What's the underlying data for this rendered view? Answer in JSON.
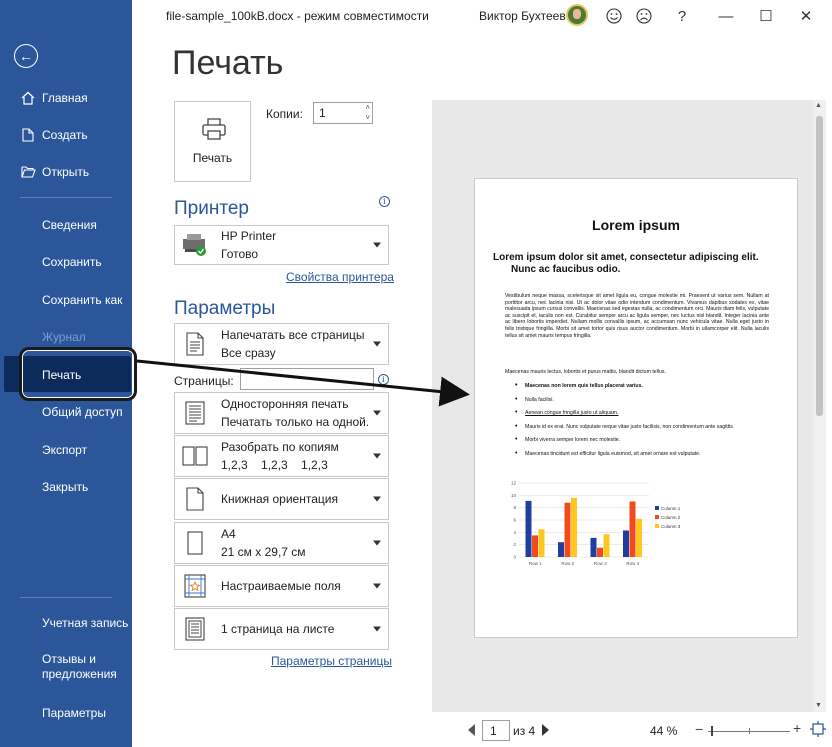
{
  "titlebar": {
    "document_title": "file-sample_100kB.docx  -  режим совместимости",
    "user_name": "Виктор Бухтеев",
    "icons": [
      "avatar",
      "smile-icon",
      "frown-icon",
      "help-icon",
      "minimize-icon",
      "maximize-icon",
      "close-icon"
    ],
    "help_glyph": "?",
    "minimize_glyph": "—",
    "maximize_glyph": "☐",
    "close_glyph": "✕"
  },
  "sidebar": {
    "back_glyph": "←",
    "items": [
      {
        "label": "Главная",
        "icon": "home-icon"
      },
      {
        "label": "Создать",
        "icon": "new-doc-icon"
      },
      {
        "label": "Открыть",
        "icon": "folder-open-icon"
      },
      {
        "label": "Сведения"
      },
      {
        "label": "Сохранить"
      },
      {
        "label": "Сохранить как"
      },
      {
        "label": "Журнал",
        "disabled": true
      },
      {
        "label": "Печать",
        "active": true
      },
      {
        "label": "Общий доступ"
      },
      {
        "label": "Экспорт"
      },
      {
        "label": "Закрыть"
      }
    ],
    "bottom_items": [
      {
        "label": "Учетная запись"
      },
      {
        "label_line1": "Отзывы и",
        "label_line2": "предложения"
      },
      {
        "label": "Параметры"
      }
    ],
    "colors": {
      "background": "#2b579a",
      "active": "#0d2a5c"
    }
  },
  "main": {
    "title": "Печать",
    "print_button_label": "Печать",
    "copies_label": "Копии:",
    "copies_value": "1",
    "printer_heading": "Принтер",
    "printer": {
      "name": "HP Printer",
      "status": "Готово"
    },
    "printer_props_link": "Свойства принтера",
    "settings_heading": "Параметры",
    "settings": [
      {
        "line1": "Напечатать все страницы",
        "line2": "Все сразу",
        "icon": "pages-icon"
      },
      {
        "line1": "Односторонняя печать",
        "line2": "Печатать только на одной...",
        "icon": "one-sided-icon"
      },
      {
        "line1": "Разобрать по копиям",
        "line2": "1,2,3    1,2,3    1,2,3",
        "icon": "collate-icon"
      },
      {
        "line1": "Книжная ориентация",
        "line2": "",
        "icon": "portrait-icon"
      },
      {
        "line1": "A4",
        "line2": "21 см x 29,7 см",
        "icon": "paper-size-icon"
      },
      {
        "line1": "Настраиваемые поля",
        "line2": "",
        "icon": "margins-icon"
      },
      {
        "line1": "1 страница на листе",
        "line2": "",
        "icon": "pages-per-sheet-icon"
      }
    ],
    "pages_label": "Страницы:",
    "pages_value": "",
    "page_setup_link": "Параметры страницы",
    "accent": "#2b579a"
  },
  "preview": {
    "doc_title": "Lorem ipsum",
    "doc_subtitle_1": "Lorem ipsum dolor sit amet, consectetur adipiscing elit.",
    "doc_subtitle_2": "Nunc ac faucibus odio.",
    "para1": "Vestibulum neque massa, scelerisque sit amet ligula eu, congue molestie mi. Praesent ut varius sem. Nullam at porttitor arcu, nec lacinia nisi. Ut ac dolor vitae odio interdum condimentum. Vivamus dapibus sodales ex, vitae malesuada ipsum cursus convallis. Maecenas sed egestas nulla, ac condimentum orci. Mauris diam felis, vulputate ac suscipit et, iaculis non est. Curabitur semper arcu ac ligula semper, nec luctus nisl blandit. Integer lacinia ante ac libero lobortis imperdiet. Nullam mollis convallis ipsum, ac accumsan nunc vehicula vitae. Nulla eget justo in felis tristique fringilla. Morbi sit amet tortor quis risus auctor condimentum. Morbi in ullamcorper elit. Nulla iaculis tellus sit amet mauris tempus fringilla.",
    "para2": "Maecenas mauris lectus, lobortis et purus mattis, blandit dictum tellus.",
    "list": [
      {
        "text": "Maecenas non lorem quis tellus placerat varius.",
        "style": "b"
      },
      {
        "text": "Nulla facilisi.",
        "style": ""
      },
      {
        "text": "Aenean congue fringilla justo ut aliquam.",
        "style": "u"
      },
      {
        "text": "Mauris id ex erat. Nunc vulputate neque vitae justo facilisis, non condimentum ante sagittis.",
        "style": ""
      },
      {
        "text": "Morbi viverra semper lorem nec molestie.",
        "style": ""
      },
      {
        "text": "Maecenas tincidunt est efficitur ligula euismod, sit amet ornare est vulputate.",
        "style": ""
      }
    ],
    "chart_data": {
      "type": "bar",
      "categories": [
        "Row 1",
        "Row 2",
        "Row 3",
        "Row 4"
      ],
      "series": [
        {
          "name": "Column 1",
          "values": [
            9.1,
            2.4,
            3.1,
            4.3
          ],
          "color": "#1f3fa0"
        },
        {
          "name": "Column 2",
          "values": [
            3.5,
            8.8,
            1.5,
            9.0
          ],
          "color": "#f04a1e"
        },
        {
          "name": "Column 3",
          "values": [
            4.5,
            9.6,
            3.7,
            6.2
          ],
          "color": "#ffc81e"
        }
      ],
      "ylim": [
        0,
        12
      ],
      "yticks": [
        "0",
        "2",
        "4",
        "6",
        "8",
        "10",
        "12"
      ],
      "legend_position": "right",
      "grid": true
    }
  },
  "bottom_nav": {
    "page_value": "1",
    "of_label": "из 4",
    "zoom_label": "44 %",
    "zoom_minus": "−",
    "zoom_plus": "+"
  }
}
